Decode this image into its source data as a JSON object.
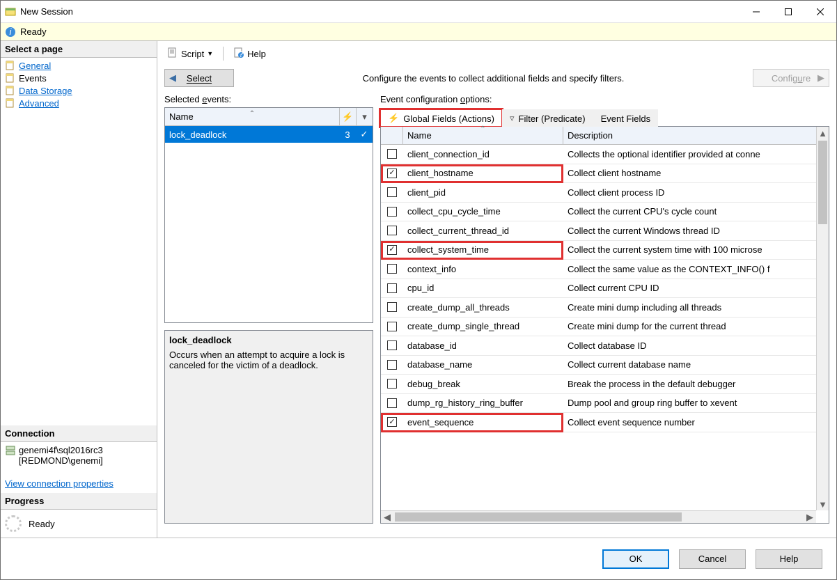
{
  "window": {
    "title": "New Session"
  },
  "readybar": {
    "text": "Ready"
  },
  "pages": {
    "header": "Select a page",
    "items": [
      "General",
      "Events",
      "Data Storage",
      "Advanced"
    ],
    "selected_index": 1
  },
  "connection": {
    "header": "Connection",
    "server": "genemi4f\\sql2016rc3",
    "user": "[REDMOND\\genemi]",
    "link": "View connection properties"
  },
  "progress": {
    "header": "Progress",
    "text": "Ready"
  },
  "toolbar": {
    "script": "Script",
    "help": "Help"
  },
  "midrow": {
    "select": "Select",
    "text": "Configure the events to collect additional fields and specify filters.",
    "configure": "Configure"
  },
  "selected_events": {
    "label": "Selected events:",
    "col_name": "Name",
    "rows": [
      {
        "name": "lock_deadlock",
        "count": "3",
        "checked": true
      }
    ]
  },
  "description": {
    "title": "lock_deadlock",
    "body": "Occurs when an attempt to acquire a lock is canceled for the victim of a deadlock."
  },
  "config": {
    "label": "Event configuration options:",
    "tabs": {
      "global": "Global Fields (Actions)",
      "filter": "Filter (Predicate)",
      "fields": "Event Fields"
    },
    "cols": {
      "name": "Name",
      "desc": "Description"
    },
    "rows": [
      {
        "checked": false,
        "name": "client_connection_id",
        "desc": "Collects the optional identifier provided at conne"
      },
      {
        "checked": true,
        "name": "client_hostname",
        "desc": "Collect client hostname"
      },
      {
        "checked": false,
        "name": "client_pid",
        "desc": "Collect client process ID"
      },
      {
        "checked": false,
        "name": "collect_cpu_cycle_time",
        "desc": "Collect the current CPU's cycle count"
      },
      {
        "checked": false,
        "name": "collect_current_thread_id",
        "desc": "Collect the current Windows thread ID"
      },
      {
        "checked": true,
        "name": "collect_system_time",
        "desc": "Collect the current system time with 100 microse"
      },
      {
        "checked": false,
        "name": "context_info",
        "desc": "Collect the same value as the CONTEXT_INFO() f"
      },
      {
        "checked": false,
        "name": "cpu_id",
        "desc": "Collect current CPU ID"
      },
      {
        "checked": false,
        "name": "create_dump_all_threads",
        "desc": "Create mini dump including all threads"
      },
      {
        "checked": false,
        "name": "create_dump_single_thread",
        "desc": "Create mini dump for the current thread"
      },
      {
        "checked": false,
        "name": "database_id",
        "desc": "Collect database ID"
      },
      {
        "checked": false,
        "name": "database_name",
        "desc": "Collect current database name"
      },
      {
        "checked": false,
        "name": "debug_break",
        "desc": "Break the process in the default debugger"
      },
      {
        "checked": false,
        "name": "dump_rg_history_ring_buffer",
        "desc": "Dump pool and group ring buffer to xevent"
      },
      {
        "checked": true,
        "name": "event_sequence",
        "desc": "Collect event sequence number"
      }
    ],
    "highlight_rows": [
      1,
      5,
      14
    ]
  },
  "footer": {
    "ok": "OK",
    "cancel": "Cancel",
    "help": "Help"
  }
}
